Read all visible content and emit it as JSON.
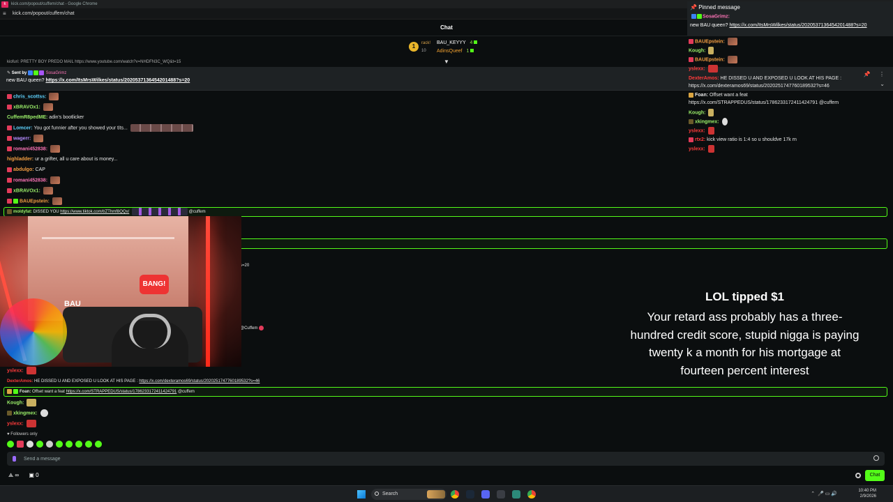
{
  "browser": {
    "window_title": "kick.com/popout/cuffem/chat - Google Chrome",
    "url": "kick.com/popout/cuffem/chat"
  },
  "header": {
    "title": "Chat"
  },
  "leaderboard": {
    "rank_badge": "1",
    "col1_top": "rack!",
    "col1_bottom": "10",
    "entries": [
      {
        "name": "BAU_KEYYY",
        "count": "4"
      },
      {
        "name": "AdinsQueef",
        "count": "1"
      }
    ]
  },
  "top_partial": "kiofuri: PRETTY BOY PREDO MAIL https://www.youtube.com/watch?v=NHDFN3C_WQ&t=15",
  "pinned_bar": {
    "sent_by_label": "Sent by",
    "sender": "SosaGrimz",
    "message_prefix": "new BAU queen? ",
    "message_link": "https://x.com/ItsMrsWilkes/status/2020537136454201488?s=20"
  },
  "chat_lines": [
    {
      "user": "chris_scottss:",
      "text": ""
    },
    {
      "user": "xBRAVOx1:",
      "text": ""
    },
    {
      "user": "CuffemR8pedME:",
      "text": "adin's bootlicker"
    },
    {
      "user": "Lomcer:",
      "text": "You got funnier after you showed your tits..."
    },
    {
      "user": "wagerr:",
      "text": ""
    },
    {
      "user": "romani452838:",
      "text": ""
    },
    {
      "user": "highladder:",
      "text": "ur a grifter, all u care about is money..."
    },
    {
      "user": "abdulgo:",
      "text": "CAP"
    },
    {
      "user": "romani452838:",
      "text": ""
    },
    {
      "user": "xBRAVOx1:",
      "text": ""
    },
    {
      "user": "BAUEpstein:",
      "text": ""
    }
  ],
  "highlight_line": {
    "user": "moldyfat:",
    "text": "DISSED YOU ",
    "link": "https://www.tiktok.com/t/ZThmf8QQx/",
    "mention": "@cuffem"
  },
  "mid_fragments": {
    "s20": "s=20",
    "cuffem": "@Cuffem"
  },
  "lower_lines": [
    {
      "user": "yslexx:",
      "text": ""
    },
    {
      "user": "DexterAmos:",
      "text": "HE DISSED U AND EXPOSED U LOOK AT HIS PAGE : ",
      "link": "https://x.com/dexteramos69/status/2020251747760189532?s=46"
    }
  ],
  "lower_highlight": {
    "user": "Foan:",
    "text": "Offset want a feat ",
    "link": "https://x.com/STRAPPEDUS/status/1786233172411424791",
    "mention": "@cuffem"
  },
  "lower_tail": [
    {
      "user": "Kough:",
      "text": ""
    },
    {
      "user": "xkingmex:",
      "text": ""
    },
    {
      "user": "yslexx:",
      "text": ""
    }
  ],
  "webcam": {
    "sign_text": "BANG!",
    "bau_text": "BAU"
  },
  "overlay": {
    "pinned_title": "Pinned message",
    "pinned_user": "SosaGrimz:",
    "pinned_text": "new BAU queen? ",
    "pinned_link": "https://x.com/ItsMrsWilkes/status/2020537136454201488?s=20",
    "lines": [
      {
        "user": "BAUEpstein:",
        "text": ""
      },
      {
        "user": "Kough:",
        "text": ""
      },
      {
        "user": "BAUEpstein:",
        "text": ""
      },
      {
        "user": "yslexx:",
        "text": ""
      },
      {
        "user": "DexterAmos:",
        "text": "HE DISSED U AND EXPOSED U LOOK AT HIS PAGE :"
      },
      {
        "user": "",
        "text": "https://x.com/dexteramos69/status/2020251747760189532?s=46"
      },
      {
        "user": "Foan:",
        "text": "Offset want a feat"
      },
      {
        "user": "",
        "text": "https://x.com/STRAPPEDUS/status/1786233172411424791 @cuffem"
      },
      {
        "user": "Kough:",
        "text": ""
      },
      {
        "user": "xkingmex:",
        "text": ""
      },
      {
        "user": "yslexx:",
        "text": ""
      },
      {
        "user": "rtx2:",
        "text": "kick view ratio is 1:4 so u shouldve 17k rn"
      },
      {
        "user": "yslexx:",
        "text": ""
      }
    ]
  },
  "tts": {
    "title": "LOL tipped $1",
    "lines": [
      "Your retard ass probably has a three-",
      "hundred credit score, stupid nigga is paying",
      "twenty k a month for his mortgage at",
      "fourteen percent interest"
    ]
  },
  "footer": {
    "followers_only": "Followers only",
    "input_placeholder": "Send a message",
    "infinity": "∞",
    "count": "0",
    "chat_button": "Chat"
  },
  "taskbar": {
    "search_label": "Search",
    "time": "10:40 PM",
    "date": "2/9/2026"
  },
  "colors": {
    "kick_green": "#53fc18",
    "background": "#0b0e0f",
    "panel": "#1e2224"
  }
}
